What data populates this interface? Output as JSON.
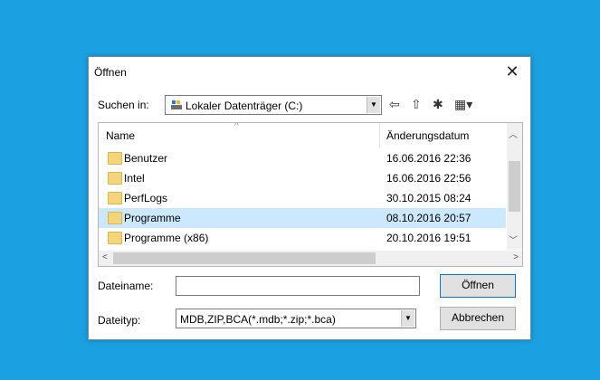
{
  "dialog": {
    "title": "Öffnen",
    "close_glyph": "✕",
    "look_in": {
      "label": "Suchen in:",
      "value": "Lokaler Datenträger (C:)"
    },
    "toolbar": {
      "back_glyph": "⇦",
      "up_glyph": "⇧",
      "new_folder_glyph": "✱",
      "view_glyph": "▦▾"
    },
    "columns": {
      "name": "Name",
      "date": "Änderungsdatum",
      "sort_glyph": "^"
    },
    "files": [
      {
        "name": "Benutzer",
        "date": "16.06.2016 22:36"
      },
      {
        "name": "Intel",
        "date": "16.06.2016 22:56"
      },
      {
        "name": "PerfLogs",
        "date": "30.10.2015 08:24"
      },
      {
        "name": "Programme",
        "date": "08.10.2016 20:57",
        "selected": true
      },
      {
        "name": "Programme (x86)",
        "date": "20.10.2016 19:51"
      }
    ],
    "filename": {
      "label": "Dateiname:",
      "value": ""
    },
    "filetype": {
      "label": "Dateityp:",
      "value": "MDB,ZIP,BCA(*.mdb;*.zip;*.bca)"
    },
    "buttons": {
      "open": "Öffnen",
      "cancel": "Abbrechen"
    },
    "colors": {
      "desktop": "#1ba1e2",
      "selection": "#cce8ff",
      "folder": "#f3d57c"
    }
  }
}
